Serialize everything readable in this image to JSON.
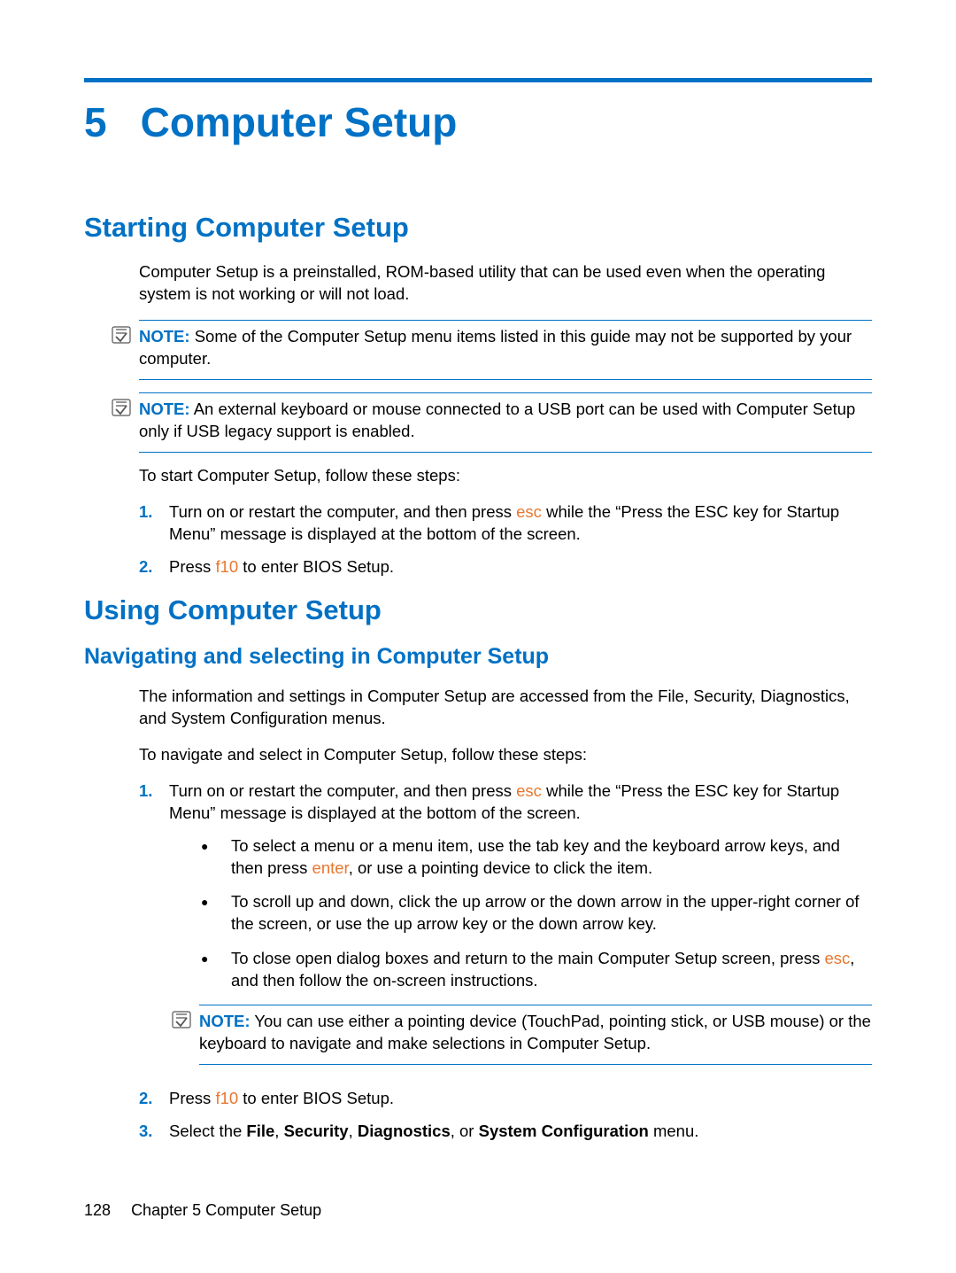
{
  "chapter": {
    "number": "5",
    "title": "Computer Setup"
  },
  "section1": {
    "heading": "Starting Computer Setup",
    "intro": "Computer Setup is a preinstalled, ROM-based utility that can be used even when the operating system is not working or will not load.",
    "note1": {
      "label": "NOTE:",
      "text": "Some of the Computer Setup menu items listed in this guide may not be supported by your computer."
    },
    "note2": {
      "label": "NOTE:",
      "text": "An external keyboard or mouse connected to a USB port can be used with Computer Setup only if USB legacy support is enabled."
    },
    "lead": "To start Computer Setup, follow these steps:",
    "step1_a": "Turn on or restart the computer, and then press ",
    "step1_key": "esc",
    "step1_b": " while the “Press the ESC key for Startup Menu” message is displayed at the bottom of the screen.",
    "step2_a": "Press ",
    "step2_key": "f10",
    "step2_b": " to enter BIOS Setup."
  },
  "section2": {
    "heading": "Using Computer Setup",
    "sub1": {
      "heading": "Navigating and selecting in Computer Setup",
      "intro": "The information and settings in Computer Setup are accessed from the File, Security, Diagnostics, and System Configuration menus.",
      "lead": "To navigate and select in Computer Setup, follow these steps:",
      "step1_a": "Turn on or restart the computer, and then press ",
      "step1_key": "esc",
      "step1_b": " while the “Press the ESC key for Startup Menu” message is displayed at the bottom of the screen.",
      "bullet1_a": "To select a menu or a menu item, use the tab key and the keyboard arrow keys, and then press ",
      "bullet1_key": "enter",
      "bullet1_b": ", or use a pointing device to click the item.",
      "bullet2": "To scroll up and down, click the up arrow or the down arrow in the upper-right corner of the screen, or use the up arrow key or the down arrow key.",
      "bullet3_a": "To close open dialog boxes and return to the main Computer Setup screen, press ",
      "bullet3_key": "esc",
      "bullet3_b": ", and then follow the on-screen instructions.",
      "note": {
        "label": "NOTE:",
        "text": "You can use either a pointing device (TouchPad, pointing stick, or USB mouse) or the keyboard to navigate and make selections in Computer Setup."
      },
      "step2_a": "Press ",
      "step2_key": "f10",
      "step2_b": " to enter BIOS Setup.",
      "step3_a": "Select the ",
      "step3_m1": "File",
      "step3_c1": ", ",
      "step3_m2": "Security",
      "step3_c2": ", ",
      "step3_m3": "Diagnostics",
      "step3_c3": ", or ",
      "step3_m4": "System Configuration",
      "step3_b": " menu."
    }
  },
  "footer": {
    "page": "128",
    "text": "Chapter 5   Computer Setup"
  },
  "markers": {
    "n1": "1.",
    "n2": "2.",
    "n3": "3.",
    "bullet": "●"
  }
}
